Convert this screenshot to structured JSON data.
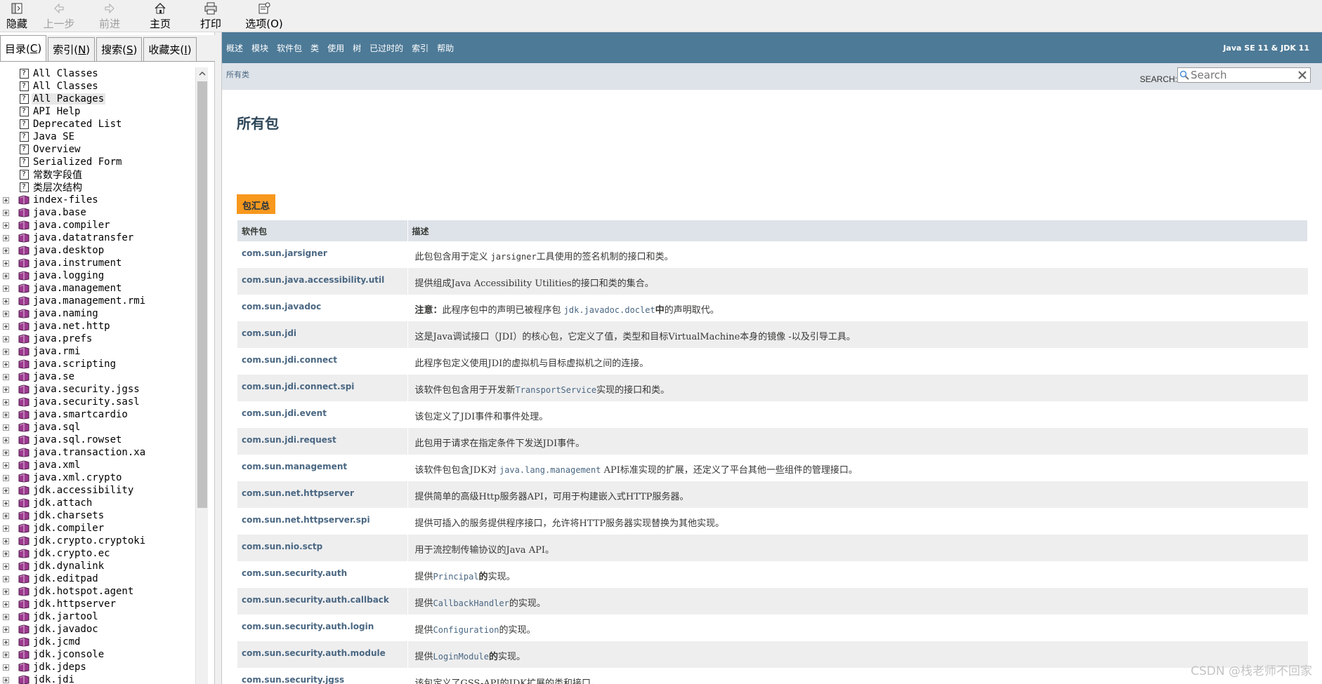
{
  "toolbar": {
    "hide": "隐藏",
    "back": "上一步",
    "forward": "前进",
    "home": "主页",
    "print": "打印",
    "options": "选项(O)"
  },
  "tabs": [
    {
      "label": "目录(C)",
      "underline": "C",
      "pre": "目录(",
      "post": ")"
    },
    {
      "label": "索引(N)",
      "pre": "索引(",
      "underline": "N",
      "post": ")"
    },
    {
      "label": "搜索(S)",
      "pre": "搜索(",
      "underline": "S",
      "post": ")"
    },
    {
      "label": "收藏夹(I)",
      "pre": "收藏夹(",
      "underline": "I",
      "post": ")"
    }
  ],
  "tree": {
    "help_items": [
      "All Classes",
      "All Classes",
      "All Packages",
      "API Help",
      "Deprecated List",
      "Java SE",
      "Overview",
      "Serialized Form",
      "常数字段值",
      "类层次结构"
    ],
    "book_items": [
      "index-files",
      "java.base",
      "java.compiler",
      "java.datatransfer",
      "java.desktop",
      "java.instrument",
      "java.logging",
      "java.management",
      "java.management.rmi",
      "java.naming",
      "java.net.http",
      "java.prefs",
      "java.rmi",
      "java.scripting",
      "java.se",
      "java.security.jgss",
      "java.security.sasl",
      "java.smartcardio",
      "java.sql",
      "java.sql.rowset",
      "java.transaction.xa",
      "java.xml",
      "java.xml.crypto",
      "jdk.accessibility",
      "jdk.attach",
      "jdk.charsets",
      "jdk.compiler",
      "jdk.crypto.cryptoki",
      "jdk.crypto.ec",
      "jdk.dynalink",
      "jdk.editpad",
      "jdk.hotspot.agent",
      "jdk.httpserver",
      "jdk.jartool",
      "jdk.javadoc",
      "jdk.jcmd",
      "jdk.jconsole",
      "jdk.jdeps",
      "jdk.jdi"
    ]
  },
  "topnav": {
    "links": [
      "概述",
      "模块",
      "软件包",
      "类",
      "使用",
      "树",
      "已过时的",
      "索引",
      "帮助"
    ],
    "about": "Java SE 11 & JDK 11"
  },
  "subnav": {
    "breadcrumb": "所有类",
    "search_label": "SEARCH:",
    "search_placeholder": "Search"
  },
  "main": {
    "title": "所有包",
    "caption": "包汇总",
    "col_package": "软件包",
    "col_desc": "描述",
    "rows": [
      {
        "pkg": "com.sun.jarsigner",
        "parts": [
          [
            "t",
            "此包包含用于定义 "
          ],
          [
            "c",
            "jarsigner"
          ],
          [
            "t",
            "工具使用的签名机制的接口和类。"
          ]
        ]
      },
      {
        "pkg": "com.sun.java.accessibility.util",
        "parts": [
          [
            "t",
            "提供组成Java Accessibility Utilities的接口和类的集合。"
          ]
        ]
      },
      {
        "pkg": "com.sun.javadoc",
        "parts": [
          [
            "b",
            "注意："
          ],
          [
            "t",
            "此程序包中的声明已被程序包 "
          ],
          [
            "l",
            "jdk.javadoc.doclet"
          ],
          [
            "b",
            "中"
          ],
          [
            "t",
            "的声明取代。"
          ]
        ]
      },
      {
        "pkg": "com.sun.jdi",
        "parts": [
          [
            "t",
            "这是Java调试接口（JDI）的核心包，它定义了值，类型和目标VirtualMachine本身的镜像 -以及引导工具。"
          ]
        ]
      },
      {
        "pkg": "com.sun.jdi.connect",
        "parts": [
          [
            "t",
            "此程序包定义使用JDI的虚拟机与目标虚拟机之间的连接。"
          ]
        ]
      },
      {
        "pkg": "com.sun.jdi.connect.spi",
        "parts": [
          [
            "t",
            "该软件包包含用于开发新"
          ],
          [
            "l",
            "TransportService"
          ],
          [
            "t",
            "实现的接口和类。"
          ]
        ]
      },
      {
        "pkg": "com.sun.jdi.event",
        "parts": [
          [
            "t",
            "该包定义了JDI事件和事件处理。"
          ]
        ]
      },
      {
        "pkg": "com.sun.jdi.request",
        "parts": [
          [
            "t",
            "此包用于请求在指定条件下发送JDI事件。"
          ]
        ]
      },
      {
        "pkg": "com.sun.management",
        "parts": [
          [
            "t",
            "该软件包包含JDK对 "
          ],
          [
            "l",
            "java.lang.management"
          ],
          [
            "t",
            " API标准实现的扩展，还定义了平台其他一些组件的管理接口。"
          ]
        ]
      },
      {
        "pkg": "com.sun.net.httpserver",
        "parts": [
          [
            "t",
            "提供简单的高级Http服务器API，可用于构建嵌入式HTTP服务器。"
          ]
        ]
      },
      {
        "pkg": "com.sun.net.httpserver.spi",
        "parts": [
          [
            "t",
            "提供可插入的服务提供程序接口，允许将HTTP服务器实现替换为其他实现。"
          ]
        ]
      },
      {
        "pkg": "com.sun.nio.sctp",
        "parts": [
          [
            "t",
            "用于流控制传输协议的Java API。"
          ]
        ]
      },
      {
        "pkg": "com.sun.security.auth",
        "parts": [
          [
            "t",
            "提供"
          ],
          [
            "l",
            "Principal"
          ],
          [
            "b",
            "的"
          ],
          [
            "t",
            "实现。"
          ]
        ]
      },
      {
        "pkg": "com.sun.security.auth.callback",
        "parts": [
          [
            "t",
            "提供"
          ],
          [
            "l",
            "CallbackHandler"
          ],
          [
            "t",
            "的实现。"
          ]
        ]
      },
      {
        "pkg": "com.sun.security.auth.login",
        "parts": [
          [
            "t",
            "提供"
          ],
          [
            "l",
            "Configuration"
          ],
          [
            "t",
            "的实现。"
          ]
        ]
      },
      {
        "pkg": "com.sun.security.auth.module",
        "parts": [
          [
            "t",
            "提供"
          ],
          [
            "l",
            "LoginModule"
          ],
          [
            "b",
            "的"
          ],
          [
            "t",
            "实现。"
          ]
        ]
      },
      {
        "pkg": "com.sun.security.jgss",
        "parts": [
          [
            "t",
            "该包定义了GSS-API的JDK扩展的类和接口。"
          ]
        ]
      }
    ]
  },
  "watermark": "CSDN @栈老师不回家"
}
